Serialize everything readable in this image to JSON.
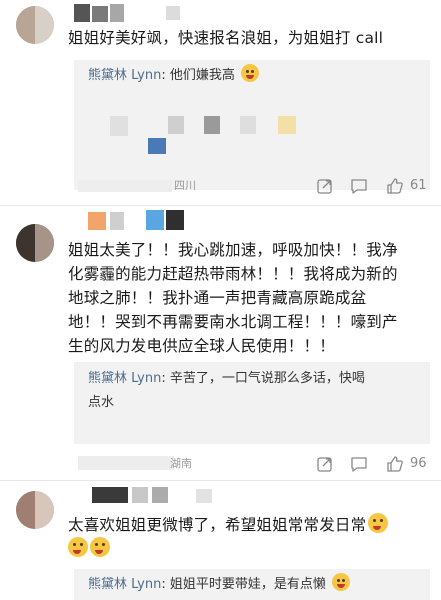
{
  "comments": [
    {
      "text": "姐姐好美好飒，快速报名浪姐，为姐姐打 call",
      "reply": {
        "name": "熊黛林 Lynn",
        "sep": ":",
        "text": "他们嫌我高",
        "emoji": "laughing-emoji"
      },
      "location": "四川",
      "likes": "61"
    },
    {
      "lines": [
        "姐姐太美了！！我心跳加速，呼吸加快！！我净",
        "化雾霾的能力赶超热带雨林！！！我将成为新的",
        "地球之肺！！我扑通一声把青藏高原跪成盆",
        "地！！哭到不再需要南水北调工程！！！嚎到产",
        "生的风力发电供应全球人民使用！！！"
      ],
      "reply": {
        "name": "熊黛林 Lynn",
        "sep": ":",
        "line1": "辛苦了，一口气说那么多话，快喝",
        "line2": "点水"
      },
      "location": "湖南",
      "likes": "96"
    },
    {
      "text": "太喜欢姐姐更微博了，希望姐姐常常发日常",
      "emoji": "heart-eyes-emoji",
      "reply": {
        "name": "熊黛林 Lynn",
        "sep": ":",
        "text": "姐姐平时要带娃，是有点懒",
        "emoji": "laughing-emoji"
      }
    }
  ],
  "icons": {
    "share": "share-icon",
    "comment": "comment-icon",
    "like": "thumbs-up-icon"
  },
  "colors": {
    "name_link": "#4e6c8f",
    "reply_bg": "#f2f2f2",
    "meta": "#999999"
  }
}
